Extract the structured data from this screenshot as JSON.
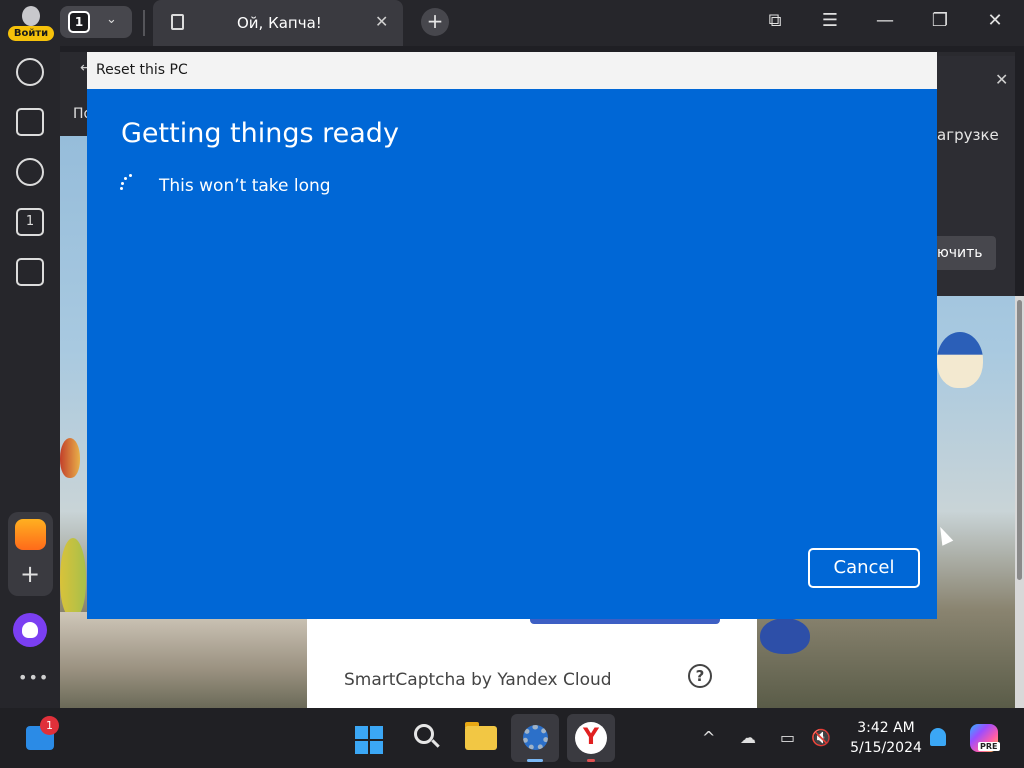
{
  "browser": {
    "login_label": "Войти",
    "tab_count": "1",
    "tab_title": "Ой, Капча!",
    "close_glyph": "✕",
    "new_tab_glyph": "+",
    "window_controls": {
      "bookmarks": "⧉",
      "menu": "☰",
      "minimize": "—",
      "restore": "❐",
      "close": "✕"
    }
  },
  "sidebar": {
    "items": [
      "history-icon",
      "collections-icon",
      "video-icon",
      "tabs-icon",
      "screenshot-icon"
    ],
    "tabs_badge": "1",
    "more": "•••",
    "plus": "+"
  },
  "page": {
    "back_glyph": "←",
    "nav_text_partial": "По",
    "popup_text_partial": "агрузке",
    "popup_button_partial": "ючить",
    "popup_close": "✕",
    "captcha_brand": "SmartCaptcha by Yandex Cloud",
    "help_glyph": "?"
  },
  "dialog": {
    "title": "Reset this PC",
    "heading": "Getting things ready",
    "subtext": "This won’t take long",
    "cancel_label": "Cancel",
    "accent_color": "#0067d6"
  },
  "taskbar": {
    "widgets_badge": "1",
    "time": "3:42 AM",
    "date": "5/15/2024",
    "copilot_badge": "PRE",
    "tray": {
      "chevron": "^",
      "cloud": "☁",
      "display": "▭",
      "volume": "🔇"
    },
    "yandex_letter": "Y"
  }
}
